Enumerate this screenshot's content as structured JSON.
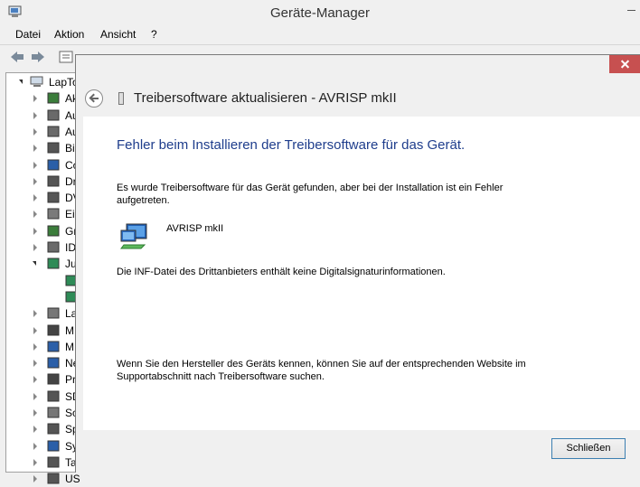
{
  "window": {
    "title": "Geräte-Manager"
  },
  "menu": {
    "items": [
      "Datei",
      "Aktion",
      "Ansicht",
      "?"
    ]
  },
  "tree": {
    "rows": [
      {
        "label": "LapTo",
        "icon": "computer-icon",
        "expander": "open"
      },
      {
        "label": "Ak",
        "icon": "audio-icon",
        "expander": "closed"
      },
      {
        "label": "Au",
        "icon": "speaker-icon",
        "expander": "closed"
      },
      {
        "label": "Au",
        "icon": "speaker-icon",
        "expander": "closed"
      },
      {
        "label": "Bi",
        "icon": "camera-icon",
        "expander": "closed"
      },
      {
        "label": "Co",
        "icon": "monitor-icon",
        "expander": "closed"
      },
      {
        "label": "Dr",
        "icon": "printer-icon",
        "expander": "closed"
      },
      {
        "label": "DV",
        "icon": "disc-drive-icon",
        "expander": "closed"
      },
      {
        "label": "Eir",
        "icon": "keyboard-icon",
        "expander": "closed"
      },
      {
        "label": "Gr",
        "icon": "display-adapter-icon",
        "expander": "closed"
      },
      {
        "label": "ID",
        "icon": "ide-controller-icon",
        "expander": "closed"
      },
      {
        "label": "Ju",
        "icon": "jungo-icon",
        "expander": "open"
      },
      {
        "label": "",
        "icon": "jungo-device-icon",
        "expander": "none"
      },
      {
        "label": "",
        "icon": "jungo-device-icon",
        "expander": "none"
      },
      {
        "label": "La",
        "icon": "drive-icon",
        "expander": "closed"
      },
      {
        "label": "M",
        "icon": "mouse-icon",
        "expander": "closed"
      },
      {
        "label": "M",
        "icon": "monitor-icon",
        "expander": "closed"
      },
      {
        "label": "Ne",
        "icon": "network-icon",
        "expander": "closed"
      },
      {
        "label": "Pr",
        "icon": "processor-icon",
        "expander": "closed"
      },
      {
        "label": "SD",
        "icon": "sd-host-icon",
        "expander": "closed"
      },
      {
        "label": "Sc",
        "icon": "usb-icon",
        "expander": "closed"
      },
      {
        "label": "Sp",
        "icon": "storage-icon",
        "expander": "closed"
      },
      {
        "label": "Sy",
        "icon": "system-icon",
        "expander": "closed"
      },
      {
        "label": "Ta",
        "icon": "keyboard-icon",
        "expander": "closed"
      },
      {
        "label": "US",
        "icon": "usb-controller-icon",
        "expander": "closed"
      }
    ]
  },
  "dialog": {
    "title": "Treibersoftware aktualisieren - AVRISP mkII",
    "heading": "Fehler beim Installieren der Treibersoftware für das Gerät.",
    "description": "Es wurde Treibersoftware für das Gerät gefunden, aber bei der Installation ist ein Fehler aufgetreten.",
    "device_name": "AVRISP mkII",
    "inf_message": "Die INF-Datei des Drittanbieters enthält keine Digitalsignaturinformationen.",
    "help_message": "Wenn Sie den Hersteller des Geräts kennen, können Sie auf der entsprechenden Website im Supportabschnitt nach Treibersoftware suchen.",
    "close_label": "Schließen"
  },
  "colors": {
    "heading": "#1e3d8c",
    "close_button": "#c75050",
    "button_border": "#3c7fb1"
  }
}
